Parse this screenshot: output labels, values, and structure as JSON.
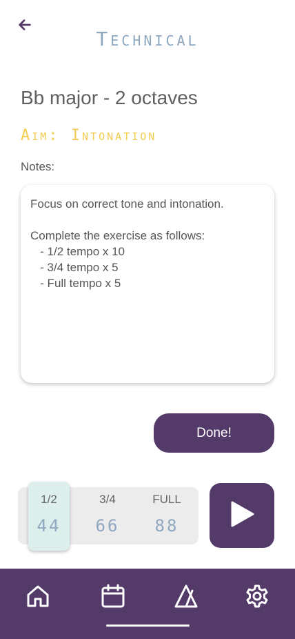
{
  "header": {
    "back_icon": "arrow-left-icon",
    "title": "Technical"
  },
  "exercise": {
    "title": "Bb major - 2 octaves",
    "aim": "Aim: Intonation",
    "notes_label": "Notes:",
    "notes_lines": [
      "Focus on correct tone and intonation.",
      "",
      "Complete the exercise as follows:",
      "   - 1/2 tempo x 10",
      "   - 3/4 tempo x 5",
      "   - Full tempo x 5"
    ]
  },
  "actions": {
    "done_label": "Done!"
  },
  "tempo": {
    "selected": "1/2",
    "options": [
      {
        "label": "1/2",
        "bpm": "44"
      },
      {
        "label": "3/4",
        "bpm": "66"
      },
      {
        "label": "FULL",
        "bpm": "88"
      }
    ],
    "play_icon": "play-icon"
  },
  "nav": {
    "items": [
      "home-icon",
      "calendar-icon",
      "metronome-icon",
      "gear-icon"
    ],
    "active": "metronome-icon"
  },
  "colors": {
    "primary": "#533a68",
    "title_accent": "#8fa7bf",
    "aim_accent": "#f2cc50",
    "tempo_active_bg": "#dcefec"
  }
}
